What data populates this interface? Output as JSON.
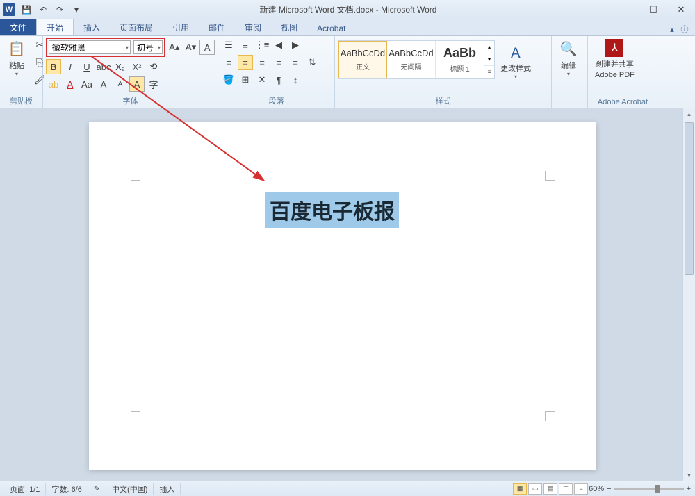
{
  "app": {
    "title": "新建 Microsoft Word 文档.docx - Microsoft Word",
    "icon_letter": "W"
  },
  "qat": {
    "save": "💾",
    "undo": "↶",
    "redo": "↷",
    "dd": "▾"
  },
  "win": {
    "min": "—",
    "max": "☐",
    "close": "✕"
  },
  "tabs": {
    "file": "文件",
    "home": "开始",
    "insert": "插入",
    "layout": "页面布局",
    "ref": "引用",
    "mail": "邮件",
    "review": "审阅",
    "view": "视图",
    "acrobat": "Acrobat",
    "help": "ⓘ"
  },
  "ribbon": {
    "clipboard": {
      "label": "剪贴板",
      "paste": "粘贴"
    },
    "font": {
      "label": "字体",
      "name": "微软雅黑",
      "size": "初号"
    },
    "paragraph": {
      "label": "段落"
    },
    "styles": {
      "label": "样式",
      "items": [
        {
          "preview": "AaBbCcDd",
          "name": "正文",
          "selected": true
        },
        {
          "preview": "AaBbCcDd",
          "name": "无间隔",
          "selected": false
        },
        {
          "preview": "AaBb",
          "name": "标题 1",
          "selected": false
        }
      ],
      "change": "更改样式"
    },
    "editing": {
      "label": "编辑"
    },
    "acrobat": {
      "line1": "创建并共享",
      "line2": "Adobe PDF",
      "label": "Adobe Acrobat"
    }
  },
  "document": {
    "text": "百度电子板报"
  },
  "status": {
    "page": "页面: 1/1",
    "words": "字数: 6/6",
    "lang": "中文(中国)",
    "mode": "插入",
    "zoom": "60%",
    "minus": "−",
    "plus": "+"
  }
}
